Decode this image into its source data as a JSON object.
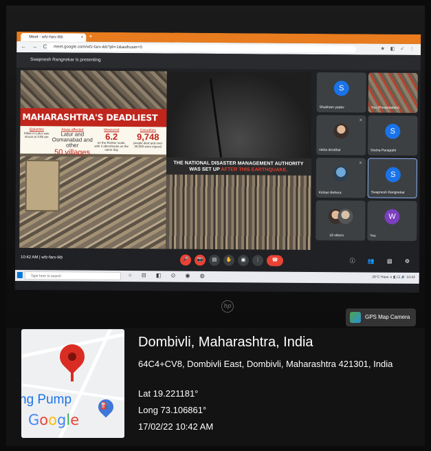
{
  "browser": {
    "tab_title": "Meet - wfz-farx-ikb",
    "tab_close": "×",
    "new_tab": "+",
    "nav_glyphs": "← → C",
    "url": "meet.google.com/wfz-farx-ikb?pli=1&authuser=0",
    "ext_glyphs": "★ ◧ ✓ ⋮"
  },
  "meet": {
    "presenting_banner": "Swapnesh Rangnekar is presenting",
    "meeting_time": "10:42 AM",
    "meeting_code": "wfz-farx-ikb",
    "participants": [
      {
        "name": "Shubham yadav",
        "initial": "S",
        "color": "#1a73e8"
      },
      {
        "name": "You (Presentation)",
        "initial": "",
        "color": ""
      },
      {
        "name": "nisha deodhar",
        "initial": "",
        "color": ""
      },
      {
        "name": "Sneha Panigrahi",
        "initial": "S",
        "color": "#1a73e8"
      },
      {
        "name": "Kishan Behera",
        "initial": "",
        "color": ""
      },
      {
        "name": "Swapnesh Rangnekar",
        "initial": "S",
        "color": "#1a73e8"
      },
      {
        "name": "18 others",
        "initial": "",
        "color": ""
      },
      {
        "name": "You",
        "initial": "W",
        "color": "#7b3fbf"
      }
    ],
    "control_glyphs": [
      "🎤",
      "📷",
      "▤",
      "✋",
      "▣",
      "⋮",
      "☎"
    ],
    "right_controls": "ⓘ 👥 ▤ ⚙"
  },
  "slide": {
    "headline": "MAHARASHTRA'S DEADLIEST EARTHQUAKE",
    "facts": [
      {
        "heading": "Epicentre",
        "text": "Killari in Latur was struck at 3:56 am"
      },
      {
        "heading": "Areas affected",
        "text": "Latur and Osmanabad and other"
      },
      {
        "heading": "Measured",
        "big": "6.2",
        "text": "on the Richter scale, with 3 aftershocks on the same day"
      },
      {
        "heading": "Casualties",
        "big": "9,748",
        "text": "people died and over 30,000 were injured"
      }
    ],
    "villages": "50 villages",
    "ndma_line1": "THE NATIONAL DISASTER MANAGEMENT AUTHORITY",
    "ndma_line2": "WAS SET UP ",
    "ndma_highlight": "AFTER THIS EARTHQUAKE."
  },
  "taskbar": {
    "search_placeholder": "Type here to search",
    "icons": "○ ⊟ ◧ ⊙ ◉ ◍",
    "tray": "26°C Haze ∧ ◧ ⊡ 🔊  10:42"
  },
  "laptop": {
    "brand": "hp"
  },
  "gps": {
    "app_name": "GPS Map Camera",
    "city": "Dombivli, Maharashtra, India",
    "address": "64C4+CV8, Dombivli East, Dombivli, Maharashtra 421301, India",
    "lat": "Lat 19.221181°",
    "long": "Long 73.106861°",
    "timestamp": "17/02/22 10:42 AM",
    "map_label": "ng Pump",
    "map_fuel_glyph": "⛽",
    "google_letters": [
      "G",
      "o",
      "o",
      "g",
      "l",
      "e"
    ]
  }
}
